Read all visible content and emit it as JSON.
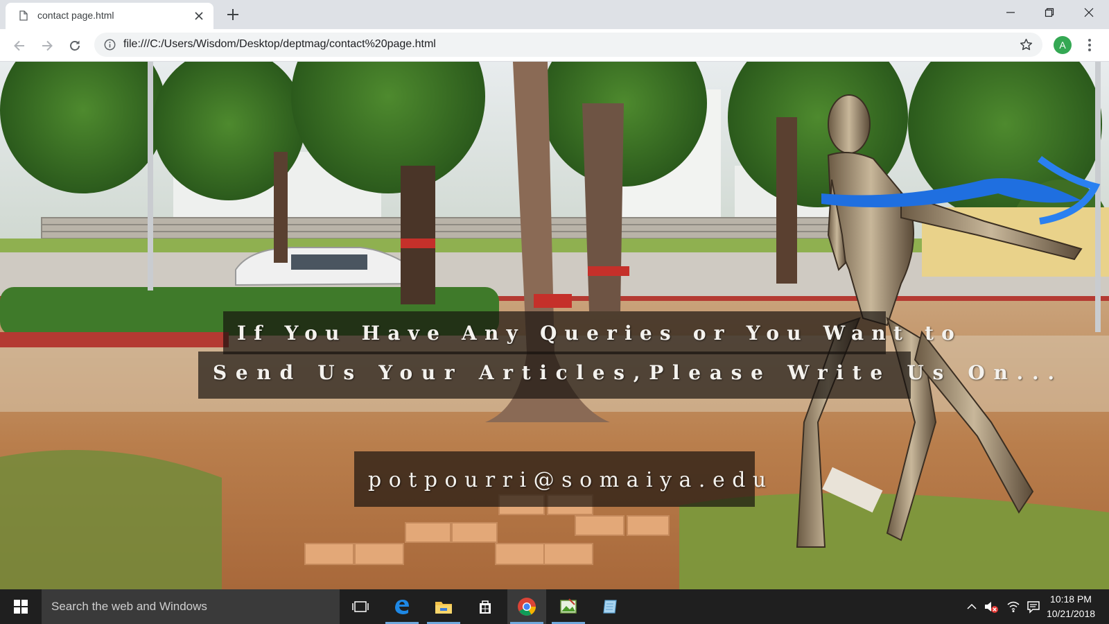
{
  "browser": {
    "tab": {
      "title": "contact page.html"
    },
    "address_bar": {
      "url": "file:///C:/Users/Wisdom/Desktop/deptmag/contact%20page.html"
    },
    "profile_initial": "A"
  },
  "page": {
    "message_line_1": "If You Have Any Queries or You Want to",
    "message_line_2": "Send Us Your Articles,Please Write Us On...",
    "email": "potpourri@somaiya.edu"
  },
  "taskbar": {
    "search_placeholder": "Search the web and Windows",
    "pinned_icons": [
      "task-view-icon",
      "edge-icon",
      "file-explorer-icon",
      "store-icon",
      "chrome-icon",
      "photos-app-icon",
      "notepad-app-icon"
    ],
    "tray_icons": [
      "show-hidden-icons-chevron",
      "volume-muted-icon",
      "wifi-icon",
      "action-center-icon"
    ],
    "time": "10:18 PM",
    "date": "10/21/2018"
  },
  "colors": {
    "tabstrip_bg": "#dee1e6",
    "omnibox_bg": "#f1f3f4",
    "banner_bg": "#14100e",
    "taskbar_bg": "#1f1f1f",
    "profile_green": "#34a853"
  }
}
